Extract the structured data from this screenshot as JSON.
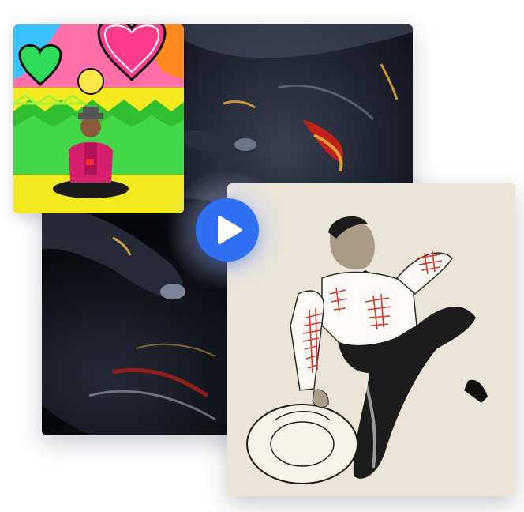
{
  "gallery": {
    "images": [
      {
        "name": "dark-body-paint-photo",
        "theme": "dark"
      },
      {
        "name": "pop-art-mural-photo",
        "theme": "colorful"
      },
      {
        "name": "fashion-sketch-illustration",
        "theme": "sketch"
      }
    ],
    "play": {
      "icon": "play-icon",
      "color": "#2f6ff2"
    }
  }
}
